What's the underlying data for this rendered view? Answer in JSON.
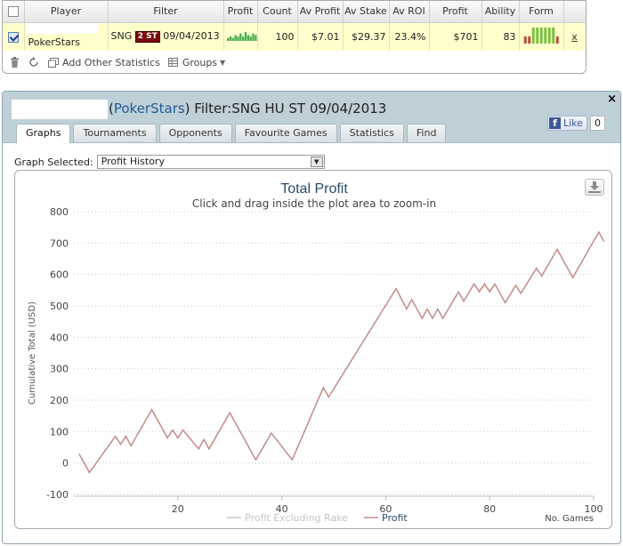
{
  "stats": {
    "headers": [
      "Player",
      "Filter",
      "Profit",
      "Count",
      "Av Profit",
      "Av Stake",
      "Av ROI",
      "Profit",
      "Ability",
      "Form"
    ],
    "row": {
      "player": "PokerStars",
      "filter_prefix": "SNG",
      "filter_badge": "2 ST",
      "filter_date": "09/04/2013",
      "count": "100",
      "av_profit": "$7.01",
      "av_stake": "$29.37",
      "av_roi": "23.4%",
      "profit": "$701",
      "ability": "83",
      "remove": "x"
    },
    "sparkline": [
      2,
      3,
      2,
      4,
      3,
      5,
      3,
      6,
      4,
      3,
      5,
      4
    ],
    "form_bars": [
      {
        "value": 0.45,
        "color": "#c44b3c"
      },
      {
        "value": 0.45,
        "color": "#c44b3c"
      },
      {
        "value": 1.0,
        "color": "#7ac143"
      },
      {
        "value": 1.0,
        "color": "#7ac143"
      },
      {
        "value": 1.0,
        "color": "#7ac143"
      },
      {
        "value": 1.0,
        "color": "#7ac143"
      },
      {
        "value": 1.0,
        "color": "#7ac143"
      },
      {
        "value": 1.0,
        "color": "#7ac143"
      },
      {
        "value": 0.45,
        "color": "#c44b3c"
      }
    ],
    "toolbar": {
      "add_stats": "Add Other Statistics",
      "groups": "Groups"
    }
  },
  "panel": {
    "title_site": "PokerStars",
    "title_suffix": "Filter:SNG HU ST 09/04/2013",
    "close": "×",
    "like_label": "Like",
    "like_count": "0",
    "tabs": [
      "Graphs",
      "Tournaments",
      "Opponents",
      "Favourite Games",
      "Statistics",
      "Find"
    ],
    "active_tab": 0,
    "graph_selected_label": "Graph Selected:",
    "graph_selected_value": "Profit History"
  },
  "chart_data": {
    "type": "line",
    "title": "Total Profit",
    "subtitle": "Click and drag inside the plot area to zoom-in",
    "ylabel": "Cumulative Total (USD)",
    "xlabel": "No. Games",
    "ylim": [
      -100,
      800
    ],
    "xlim": [
      0,
      100
    ],
    "yticks": [
      -100,
      0,
      100,
      200,
      300,
      400,
      500,
      600,
      700,
      800
    ],
    "xticks": [
      20,
      40,
      60,
      80,
      100
    ],
    "grid": true,
    "legend_position": "bottom",
    "series": [
      {
        "name": "Profit Excluding Rake",
        "color": "#c8c8c8",
        "visible": false,
        "points": []
      },
      {
        "name": "Profit",
        "color": "#c48a8a",
        "visible": true,
        "points": [
          [
            1,
            29
          ],
          [
            3,
            -30
          ],
          [
            8,
            85
          ],
          [
            9,
            60
          ],
          [
            10,
            85
          ],
          [
            11,
            55
          ],
          [
            15,
            170
          ],
          [
            18,
            80
          ],
          [
            19,
            105
          ],
          [
            20,
            80
          ],
          [
            21,
            105
          ],
          [
            24,
            45
          ],
          [
            25,
            75
          ],
          [
            26,
            45
          ],
          [
            30,
            160
          ],
          [
            35,
            10
          ],
          [
            38,
            95
          ],
          [
            42,
            10
          ],
          [
            48,
            240
          ],
          [
            49,
            210
          ],
          [
            62,
            555
          ],
          [
            64,
            490
          ],
          [
            65,
            520
          ],
          [
            67,
            460
          ],
          [
            68,
            490
          ],
          [
            69,
            460
          ],
          [
            70,
            490
          ],
          [
            71,
            460
          ],
          [
            74,
            545
          ],
          [
            75,
            515
          ],
          [
            77,
            570
          ],
          [
            78,
            545
          ],
          [
            79,
            570
          ],
          [
            80,
            545
          ],
          [
            81,
            570
          ],
          [
            83,
            510
          ],
          [
            85,
            565
          ],
          [
            86,
            540
          ],
          [
            89,
            620
          ],
          [
            90,
            595
          ],
          [
            93,
            680
          ],
          [
            96,
            590
          ],
          [
            101,
            735
          ],
          [
            102,
            705
          ]
        ]
      }
    ]
  }
}
